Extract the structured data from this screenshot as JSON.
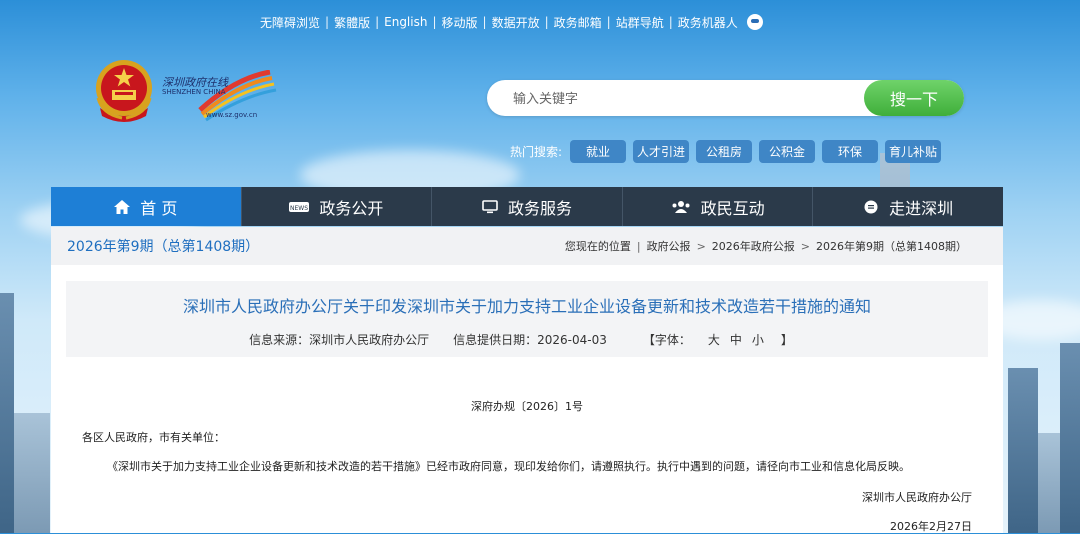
{
  "top_links": [
    "无障碍浏览",
    "繁體版",
    "English",
    "移动版",
    "数据开放",
    "政务邮箱",
    "站群导航",
    "政务机器人"
  ],
  "logo": {
    "url_text": "www.sz.gov.cn",
    "sz_brand": "SHENZHEN CHINA",
    "sz_calligraphy": "深圳政府在线"
  },
  "search": {
    "placeholder": "输入关键字",
    "button": "搜一下"
  },
  "hot_search": {
    "label": "热门搜索:",
    "tags": [
      "就业",
      "人才引进",
      "公租房",
      "公积金",
      "环保",
      "育儿补贴"
    ]
  },
  "nav": [
    {
      "label": "首 页",
      "icon": "home-icon"
    },
    {
      "label": "政务公开",
      "icon": "news-icon"
    },
    {
      "label": "政务服务",
      "icon": "monitor-icon"
    },
    {
      "label": "政民互动",
      "icon": "people-icon"
    },
    {
      "label": "走进深圳",
      "icon": "chat-icon"
    }
  ],
  "issue": "2026年第9期（总第1408期）",
  "breadcrumb": [
    "您现在的位置",
    "政府公报",
    "2026年政府公报",
    "2026年第9期（总第1408期）"
  ],
  "doc": {
    "title": "深圳市人民政府办公厅关于印发深圳市关于加力支持工业企业设备更新和技术改造若干措施的通知",
    "source": "信息来源：深圳市人民政府办公厅",
    "date": "信息提供日期：2026-04-03",
    "font_label": "【字体：",
    "font_sizes": [
      "大",
      "中",
      "小"
    ],
    "font_end": "】",
    "number": "深府办规〔2026〕1号",
    "salutation": "各区人民政府，市有关单位：",
    "body": "《深圳市关于加力支持工业企业设备更新和技术改造的若干措施》已经市政府同意，现印发给你们，请遵照执行。执行中遇到的问题，请径向市工业和信息化局反映。",
    "issuer": "深圳市人民政府办公厅",
    "issue_date": "2026年2月27日"
  }
}
